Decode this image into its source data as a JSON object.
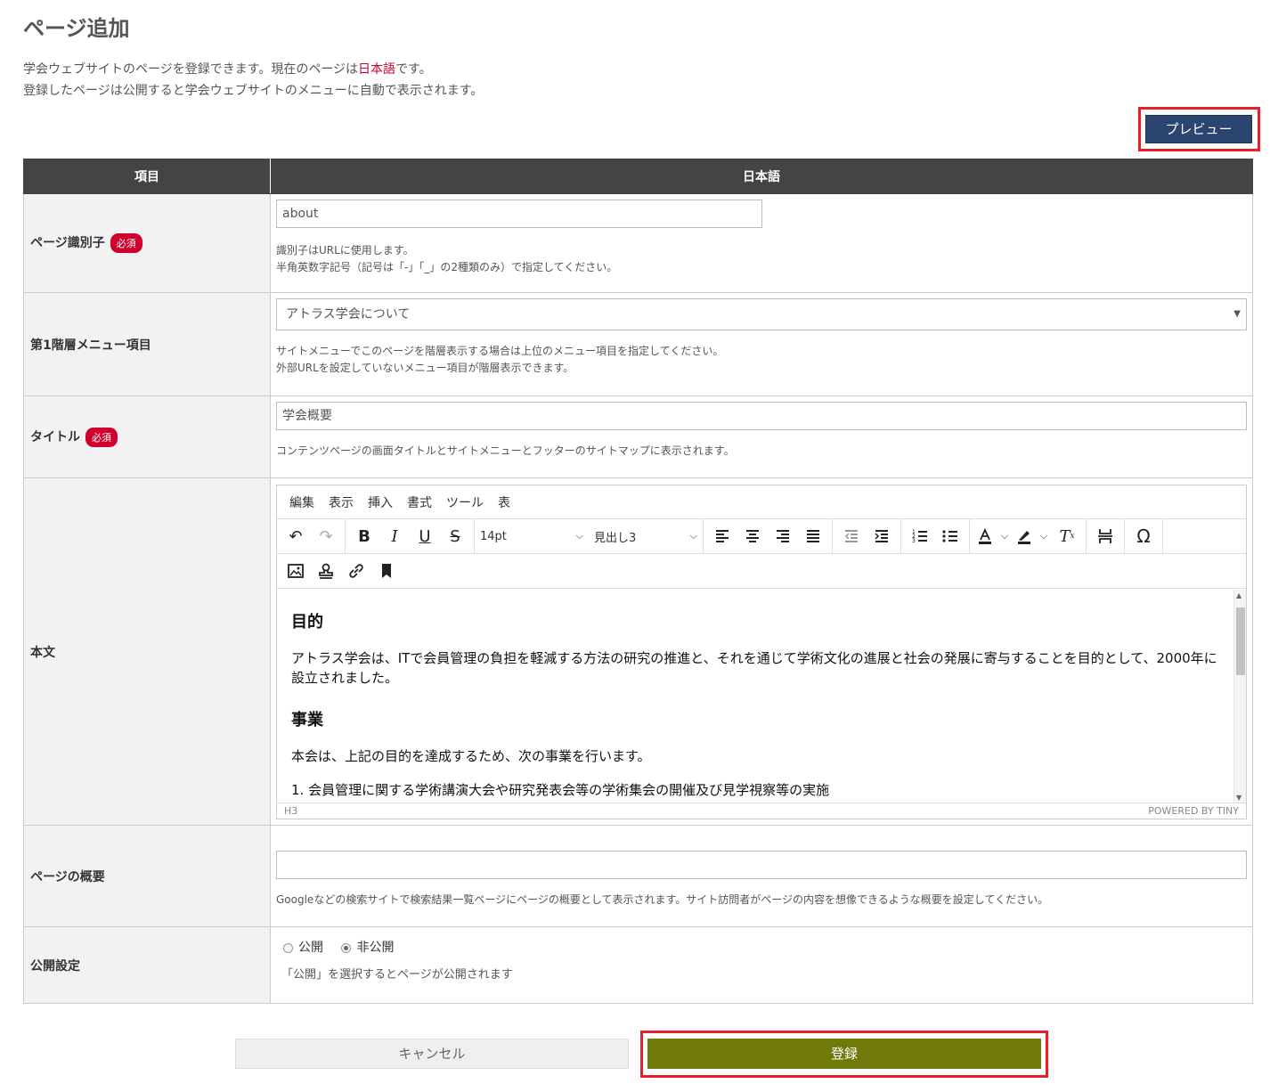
{
  "page": {
    "title": "ページ追加",
    "intro_line1_pre": "学会ウェブサイトのページを登録できます。現在のページは",
    "intro_line1_lang": "日本語",
    "intro_line1_post": "です。",
    "intro_line2": "登録したページは公開すると学会ウェブサイトのメニューに自動で表示されます。"
  },
  "buttons": {
    "preview": "プレビュー",
    "cancel": "キャンセル",
    "submit": "登録"
  },
  "table": {
    "col_item": "項目",
    "col_lang": "日本語"
  },
  "required_badge": "必須",
  "fields": {
    "identifier": {
      "label": "ページ識別子",
      "value": "about",
      "help1": "識別子はURLに使用します。",
      "help2": "半角英数字記号（記号は「-」「_」の2種類のみ）で指定してください。"
    },
    "menu": {
      "label": "第1階層メニュー項目",
      "selected": "アトラス学会について",
      "help1": "サイトメニューでこのページを階層表示する場合は上位のメニュー項目を指定してください。",
      "help2": "外部URLを設定していないメニュー項目が階層表示できます。"
    },
    "title": {
      "label": "タイトル",
      "value": "学会概要",
      "help": "コンテンツページの画面タイトルとサイトメニューとフッターのサイトマップに表示されます。"
    },
    "body": {
      "label": "本文"
    },
    "summary": {
      "label": "ページの概要",
      "value": "",
      "help": "Googleなどの検索サイトで検索結果一覧ページにページの概要として表示されます。サイト訪問者がページの内容を想像できるような概要を設定してください。"
    },
    "publish": {
      "label": "公開設定",
      "option_public": "公開",
      "option_private": "非公開",
      "selected": "非公開",
      "help": "「公開」を選択するとページが公開されます"
    }
  },
  "editor": {
    "menus": [
      "編集",
      "表示",
      "挿入",
      "書式",
      "ツール",
      "表"
    ],
    "font_size": "14pt",
    "block_format": "見出し3",
    "status_path": "H3",
    "powered_by": "POWERED BY TINY",
    "content": {
      "h1": "目的",
      "p1": "アトラス学会は、ITで会員管理の負担を軽減する方法の研究の推進と、それを通じて学術文化の進展と社会の発展に寄与することを目的として、2000年に設立されました。",
      "h2": "事業",
      "p2": "本会は、上記の目的を達成するため、次の事業を行います。",
      "li1": "1. 会員管理に関する学術講演大会や研究発表会等の学術集会の開催及び見学視察等の実施"
    },
    "icons": [
      "undo-icon",
      "redo-icon",
      "bold-icon",
      "italic-icon",
      "underline-icon",
      "strikethrough-icon",
      "align-left-icon",
      "align-center-icon",
      "align-right-icon",
      "align-justify-icon",
      "outdent-icon",
      "indent-icon",
      "numbered-list-icon",
      "bullet-list-icon",
      "text-color-icon",
      "highlight-color-icon",
      "clear-format-icon",
      "page-break-icon",
      "special-char-icon",
      "image-icon",
      "stamp-icon",
      "link-icon",
      "bookmark-icon"
    ]
  },
  "colors": {
    "header_bg": "#444444",
    "required": "#d0002e",
    "preview_btn": "#2a4670",
    "submit_btn": "#6f7a0a",
    "highlight": "#e8202a"
  }
}
